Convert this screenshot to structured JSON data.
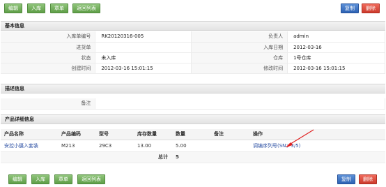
{
  "toolbar": {
    "edit_label": "编辑",
    "stockin_label": "入库",
    "void_label": "章单",
    "back_label": "返回列表",
    "copy_label": "复制",
    "delete_label": "删除"
  },
  "basic": {
    "title": "基本信息",
    "rows": [
      {
        "l1": "入库单编号",
        "v1": "RK20120316-005",
        "l2": "负责人",
        "v2": "admin"
      },
      {
        "l1": "进货单",
        "v1": "",
        "l2": "入库日期",
        "v2": "2012-03-16"
      },
      {
        "l1": "状态",
        "v1": "未入库",
        "l2": "仓库",
        "v2": "1号仓库"
      },
      {
        "l1": "创建时间",
        "v1": "2012-03-16 15:01:15",
        "l2": "修改时间",
        "v2": "2012-03-16 15:01:15"
      }
    ]
  },
  "desc": {
    "title": "描述信息",
    "remark_label": "备注",
    "remark_value": ""
  },
  "products": {
    "title": "产品详细信息",
    "columns": [
      "产品名称",
      "产品编码",
      "型号",
      "库存数量",
      "数量",
      "备注",
      "操作"
    ],
    "rows": [
      {
        "name": "安控小摄入套装",
        "code": "M213",
        "model": "29C3",
        "stock": "13.00",
        "qty": "5.00",
        "remark": "",
        "action": "调编序列号(SN：3/5)"
      }
    ],
    "total_label": "总计",
    "total_value": "5"
  },
  "colors": {
    "green": "#5f9e48",
    "blue": "#2d62b4",
    "red": "#cc3a2c",
    "link": "#2b4fa3",
    "annotation_arrow": "#e02020"
  }
}
